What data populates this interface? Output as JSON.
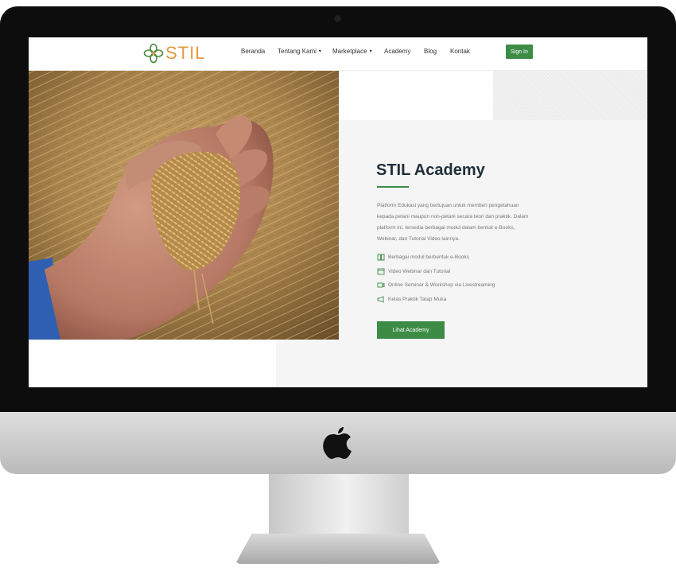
{
  "header": {
    "logo_text": "STIL",
    "nav": [
      {
        "label": "Beranda",
        "caret": ""
      },
      {
        "label": "Tentang Kami",
        "caret": "▾"
      },
      {
        "label": "Marketplace",
        "caret": "▾"
      },
      {
        "label": "Academy",
        "caret": ""
      },
      {
        "label": "Blog",
        "caret": ""
      },
      {
        "label": "Kontak",
        "caret": ""
      }
    ],
    "signin_label": "Sign In"
  },
  "hero": {
    "title": "STIL Academy",
    "description": "Platform Edukasi yang bertujuan untuk memberi pengetahuan kepada petani maupun non-petani secara teori dan praktik. Dalam platform ini, tersedia berbagai modul dalam bentuk e-Books, Webinar, dan Tutorial Video lainnya.",
    "features": [
      {
        "icon": "book-icon",
        "label": "Berbagai modul berbentuk e-Books"
      },
      {
        "icon": "video-icon",
        "label": "Video Webinar dan Tutorial"
      },
      {
        "icon": "camera-icon",
        "label": "Online Seminar & Workshop via Livestreaming"
      },
      {
        "icon": "megaphone-icon",
        "label": "Kelas Praktik Tatap Muka"
      }
    ],
    "cta_label": "Lihat Academy"
  },
  "colors": {
    "accent": "#3c8c45",
    "title": "#1f2e3a",
    "logo": "#e29a3f"
  }
}
